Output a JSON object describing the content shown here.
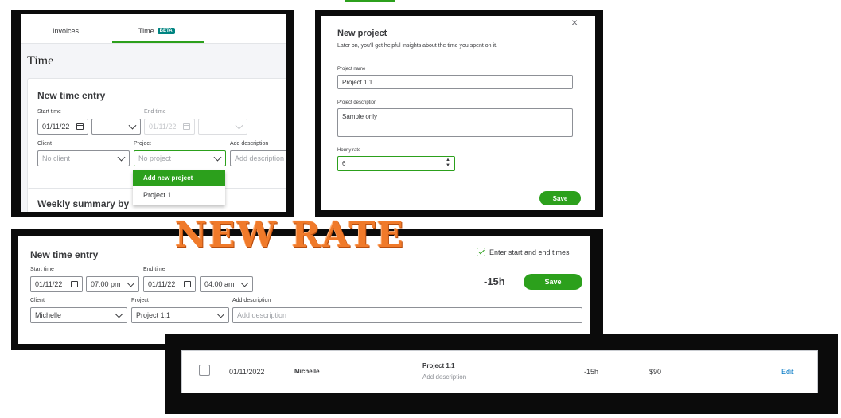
{
  "panel1": {
    "tabs": [
      {
        "label": "Invoices"
      },
      {
        "label": "Time",
        "badge": "BETA"
      }
    ],
    "page_title": "Time",
    "card_title": "New time entry",
    "start_time_label": "Start time",
    "start_date": "01/11/22",
    "end_time_label": "End time",
    "end_date": "01/11/22",
    "client_label": "Client",
    "client_placeholder": "No client",
    "project_label": "Project",
    "project_placeholder": "No project",
    "add_description_label": "Add description",
    "add_description_placeholder": "Add description",
    "dropdown": {
      "add_new": "Add new project",
      "option": "Project 1"
    },
    "weekly_summary": "Weekly summary by"
  },
  "panel2": {
    "title": "New project",
    "subtitle": "Later on, you'll get helpful insights about the time you spent on it.",
    "project_name_label": "Project name",
    "project_name_value": "Project 1.1",
    "project_description_label": "Project description",
    "project_description_value": "Sample only",
    "hourly_rate_label": "Hourly rate",
    "hourly_rate_value": "6",
    "save_label": "Save",
    "close_glyph": "×"
  },
  "overlay_text": "NEW RATE",
  "panel3": {
    "title": "New time entry",
    "checkbox_label": "Enter start and end times",
    "checkbox_checked": true,
    "start_time_label": "Start time",
    "start_date": "01/11/22",
    "start_time": "07:00 pm",
    "end_time_label": "End time",
    "end_date": "01/11/22",
    "end_time": "04:00 am",
    "duration": "-15h",
    "save_label": "Save",
    "client_label": "Client",
    "client_value": "Michelle",
    "project_label": "Project",
    "project_value": "Project 1.1",
    "add_description_label": "Add description",
    "add_description_placeholder": "Add description"
  },
  "panel4": {
    "date": "01/11/2022",
    "client": "Michelle",
    "project": "Project 1.1",
    "description_placeholder": "Add description",
    "duration": "-15h",
    "amount": "$90",
    "edit_label": "Edit"
  },
  "colors": {
    "accent_green": "#2ca01c",
    "link_blue": "#0077c5",
    "overlay_orange": "#f07a2a"
  }
}
